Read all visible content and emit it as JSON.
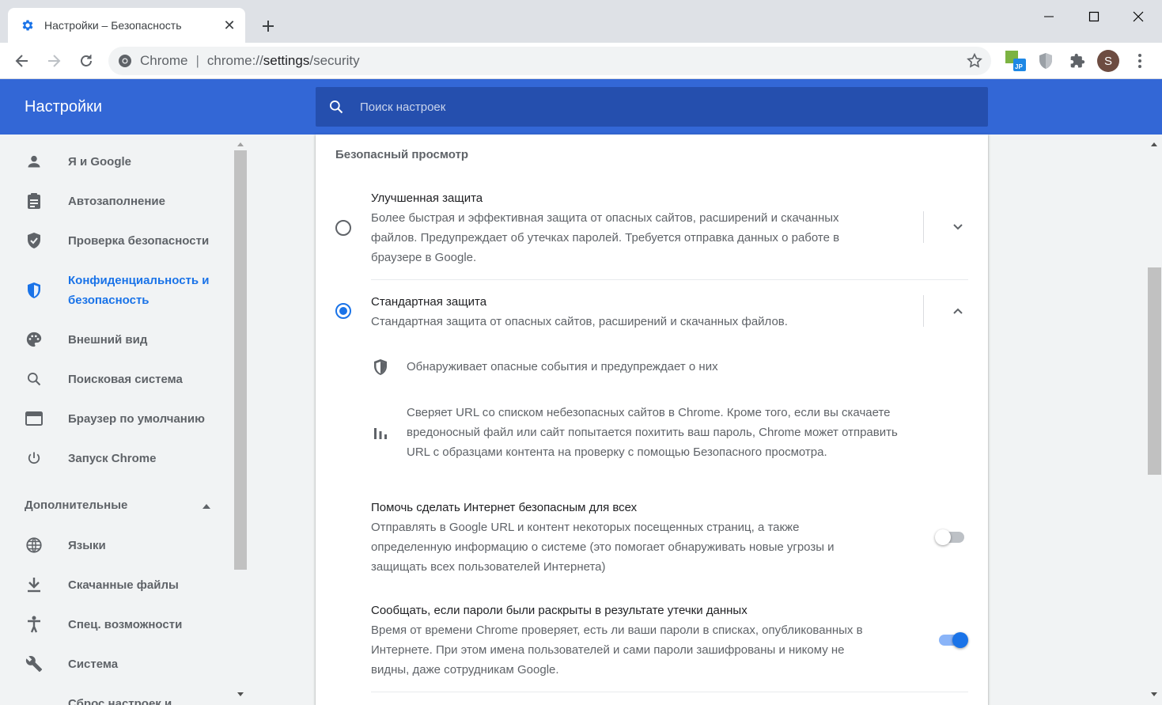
{
  "tab": {
    "title": "Настройки – Безопасность",
    "close": "✕",
    "new": "+"
  },
  "window": {
    "minimize": "—",
    "maximize": "☐",
    "close": "✕"
  },
  "omnibox": {
    "origin": "Chrome",
    "separator": "|",
    "url_prefix": "chrome://",
    "url_host": "settings",
    "url_path": "/security"
  },
  "profile": {
    "initial": "S"
  },
  "header": {
    "title": "Настройки",
    "search_placeholder": "Поиск настроек"
  },
  "sidebar": {
    "items": [
      {
        "label": "Я и Google",
        "icon": "person-icon"
      },
      {
        "label": "Автозаполнение",
        "icon": "clipboard-icon"
      },
      {
        "label": "Проверка безопасности",
        "icon": "shield-check-icon"
      },
      {
        "label": "Конфиденциальность и",
        "label2": "безопасность",
        "icon": "shield-icon",
        "active": true
      },
      {
        "label": "Внешний вид",
        "icon": "palette-icon"
      },
      {
        "label": "Поисковая система",
        "icon": "search-icon"
      },
      {
        "label": "Браузер по умолчанию",
        "icon": "browser-icon"
      },
      {
        "label": "Запуск Chrome",
        "icon": "power-icon"
      }
    ],
    "advanced_label": "Дополнительные",
    "advanced_items": [
      {
        "label": "Языки",
        "icon": "globe-icon"
      },
      {
        "label": "Скачанные файлы",
        "icon": "download-icon"
      },
      {
        "label": "Спец. возможности",
        "icon": "accessibility-icon"
      },
      {
        "label": "Система",
        "icon": "wrench-icon"
      },
      {
        "label": "Сброс настроек и",
        "icon": "reset-icon"
      }
    ]
  },
  "main": {
    "section_title": "Безопасный просмотр",
    "enhanced": {
      "title": "Улучшенная защита",
      "desc": [
        "Более быстрая и эффективная защита от опасных сайтов, расширений и скачанных",
        "файлов. Предупреждает об утечках паролей. Требуется отправка данных о работе в",
        "браузере в Google."
      ],
      "selected": false
    },
    "standard": {
      "title": "Стандартная защита",
      "desc": "Стандартная защита от опасных сайтов, расширений и скачанных файлов.",
      "selected": true,
      "bullet1": "Обнаруживает опасные события и предупреждает о них",
      "bullet2": [
        "Сверяет URL со списком небезопасных сайтов в Chrome. Кроме того, если вы скачаете",
        "вредоносный файл или сайт попытается похитить ваш пароль, Chrome может отправить",
        "URL с образцами контента на проверку с помощью Безопасного просмотра."
      ]
    },
    "help": {
      "title": "Помочь сделать Интернет безопасным для всех",
      "desc": [
        "Отправлять в Google URL и контент некоторых посещенных страниц, а также",
        "определенную информацию о системе (это помогает обнаруживать новые угрозы и",
        "защищать всех пользователей Интернета)"
      ],
      "enabled": false
    },
    "leaks": {
      "title": "Сообщать, если пароли были раскрыты в результате утечки данных",
      "desc": [
        "Время от времени Chrome проверяет, есть ли ваши пароли в списках, опубликованных в",
        "Интернете. При этом имена пользователей и сами пароли зашифрованы и никому не",
        "видны, даже сотрудникам Google."
      ],
      "enabled": true
    }
  },
  "colors": {
    "accent": "#1a73e8",
    "header": "#3367d6",
    "search_bg": "#254fae"
  }
}
